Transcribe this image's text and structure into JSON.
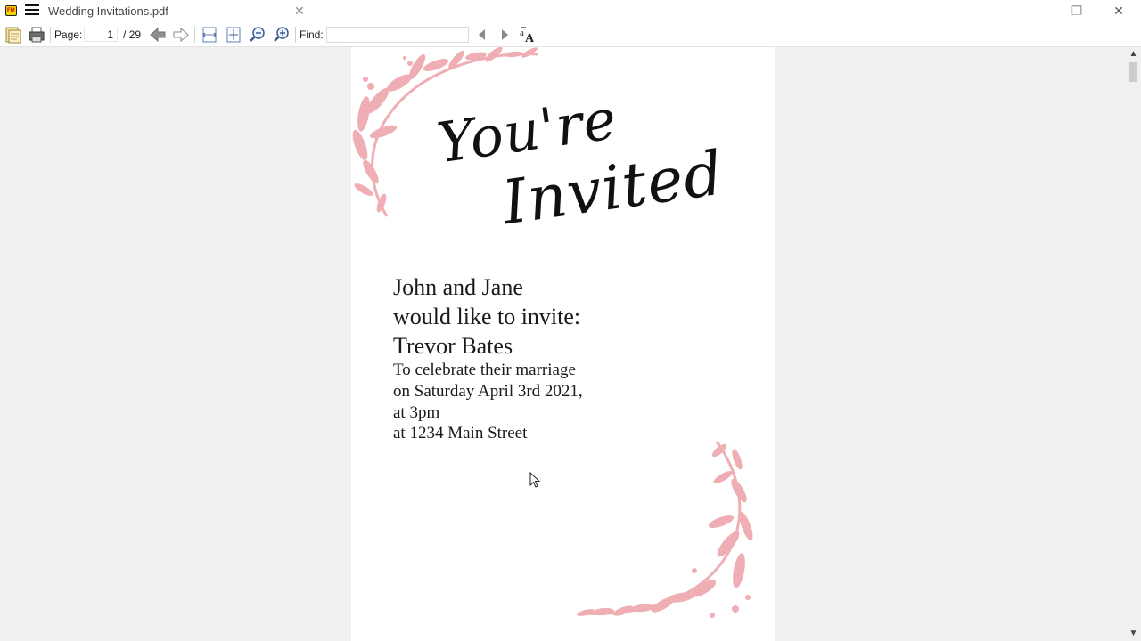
{
  "window": {
    "tab_title": "Wedding Invitations.pdf",
    "tab_close": "✕",
    "minimize": "—",
    "maximize": "❐",
    "close": "✕"
  },
  "toolbar": {
    "page_label": "Page:",
    "current_page": "1",
    "total_pages": "/ 29",
    "find_label": "Find:",
    "find_value": ""
  },
  "document": {
    "heading_line1": "You're",
    "heading_line2": "Invited",
    "lines": [
      "John and Jane",
      "would like to invite:",
      "Trevor Bates",
      "To celebrate their marriage",
      "on Saturday April 3rd 2021,",
      "at 3pm",
      "at 1234 Main Street"
    ],
    "accent_color": "#eeaeb4"
  },
  "scrollbar": {
    "up": "▲",
    "down": "▼"
  }
}
